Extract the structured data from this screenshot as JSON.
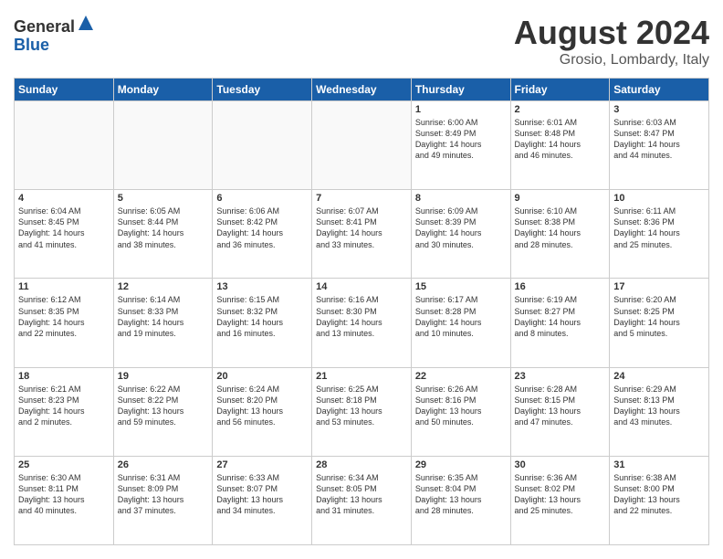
{
  "header": {
    "logo_general": "General",
    "logo_blue": "Blue",
    "month_title": "August 2024",
    "subtitle": "Grosio, Lombardy, Italy"
  },
  "weekdays": [
    "Sunday",
    "Monday",
    "Tuesday",
    "Wednesday",
    "Thursday",
    "Friday",
    "Saturday"
  ],
  "weeks": [
    [
      {
        "day": "",
        "info": ""
      },
      {
        "day": "",
        "info": ""
      },
      {
        "day": "",
        "info": ""
      },
      {
        "day": "",
        "info": ""
      },
      {
        "day": "1",
        "info": "Sunrise: 6:00 AM\nSunset: 8:49 PM\nDaylight: 14 hours\nand 49 minutes."
      },
      {
        "day": "2",
        "info": "Sunrise: 6:01 AM\nSunset: 8:48 PM\nDaylight: 14 hours\nand 46 minutes."
      },
      {
        "day": "3",
        "info": "Sunrise: 6:03 AM\nSunset: 8:47 PM\nDaylight: 14 hours\nand 44 minutes."
      }
    ],
    [
      {
        "day": "4",
        "info": "Sunrise: 6:04 AM\nSunset: 8:45 PM\nDaylight: 14 hours\nand 41 minutes."
      },
      {
        "day": "5",
        "info": "Sunrise: 6:05 AM\nSunset: 8:44 PM\nDaylight: 14 hours\nand 38 minutes."
      },
      {
        "day": "6",
        "info": "Sunrise: 6:06 AM\nSunset: 8:42 PM\nDaylight: 14 hours\nand 36 minutes."
      },
      {
        "day": "7",
        "info": "Sunrise: 6:07 AM\nSunset: 8:41 PM\nDaylight: 14 hours\nand 33 minutes."
      },
      {
        "day": "8",
        "info": "Sunrise: 6:09 AM\nSunset: 8:39 PM\nDaylight: 14 hours\nand 30 minutes."
      },
      {
        "day": "9",
        "info": "Sunrise: 6:10 AM\nSunset: 8:38 PM\nDaylight: 14 hours\nand 28 minutes."
      },
      {
        "day": "10",
        "info": "Sunrise: 6:11 AM\nSunset: 8:36 PM\nDaylight: 14 hours\nand 25 minutes."
      }
    ],
    [
      {
        "day": "11",
        "info": "Sunrise: 6:12 AM\nSunset: 8:35 PM\nDaylight: 14 hours\nand 22 minutes."
      },
      {
        "day": "12",
        "info": "Sunrise: 6:14 AM\nSunset: 8:33 PM\nDaylight: 14 hours\nand 19 minutes."
      },
      {
        "day": "13",
        "info": "Sunrise: 6:15 AM\nSunset: 8:32 PM\nDaylight: 14 hours\nand 16 minutes."
      },
      {
        "day": "14",
        "info": "Sunrise: 6:16 AM\nSunset: 8:30 PM\nDaylight: 14 hours\nand 13 minutes."
      },
      {
        "day": "15",
        "info": "Sunrise: 6:17 AM\nSunset: 8:28 PM\nDaylight: 14 hours\nand 10 minutes."
      },
      {
        "day": "16",
        "info": "Sunrise: 6:19 AM\nSunset: 8:27 PM\nDaylight: 14 hours\nand 8 minutes."
      },
      {
        "day": "17",
        "info": "Sunrise: 6:20 AM\nSunset: 8:25 PM\nDaylight: 14 hours\nand 5 minutes."
      }
    ],
    [
      {
        "day": "18",
        "info": "Sunrise: 6:21 AM\nSunset: 8:23 PM\nDaylight: 14 hours\nand 2 minutes."
      },
      {
        "day": "19",
        "info": "Sunrise: 6:22 AM\nSunset: 8:22 PM\nDaylight: 13 hours\nand 59 minutes."
      },
      {
        "day": "20",
        "info": "Sunrise: 6:24 AM\nSunset: 8:20 PM\nDaylight: 13 hours\nand 56 minutes."
      },
      {
        "day": "21",
        "info": "Sunrise: 6:25 AM\nSunset: 8:18 PM\nDaylight: 13 hours\nand 53 minutes."
      },
      {
        "day": "22",
        "info": "Sunrise: 6:26 AM\nSunset: 8:16 PM\nDaylight: 13 hours\nand 50 minutes."
      },
      {
        "day": "23",
        "info": "Sunrise: 6:28 AM\nSunset: 8:15 PM\nDaylight: 13 hours\nand 47 minutes."
      },
      {
        "day": "24",
        "info": "Sunrise: 6:29 AM\nSunset: 8:13 PM\nDaylight: 13 hours\nand 43 minutes."
      }
    ],
    [
      {
        "day": "25",
        "info": "Sunrise: 6:30 AM\nSunset: 8:11 PM\nDaylight: 13 hours\nand 40 minutes."
      },
      {
        "day": "26",
        "info": "Sunrise: 6:31 AM\nSunset: 8:09 PM\nDaylight: 13 hours\nand 37 minutes."
      },
      {
        "day": "27",
        "info": "Sunrise: 6:33 AM\nSunset: 8:07 PM\nDaylight: 13 hours\nand 34 minutes."
      },
      {
        "day": "28",
        "info": "Sunrise: 6:34 AM\nSunset: 8:05 PM\nDaylight: 13 hours\nand 31 minutes."
      },
      {
        "day": "29",
        "info": "Sunrise: 6:35 AM\nSunset: 8:04 PM\nDaylight: 13 hours\nand 28 minutes."
      },
      {
        "day": "30",
        "info": "Sunrise: 6:36 AM\nSunset: 8:02 PM\nDaylight: 13 hours\nand 25 minutes."
      },
      {
        "day": "31",
        "info": "Sunrise: 6:38 AM\nSunset: 8:00 PM\nDaylight: 13 hours\nand 22 minutes."
      }
    ]
  ]
}
